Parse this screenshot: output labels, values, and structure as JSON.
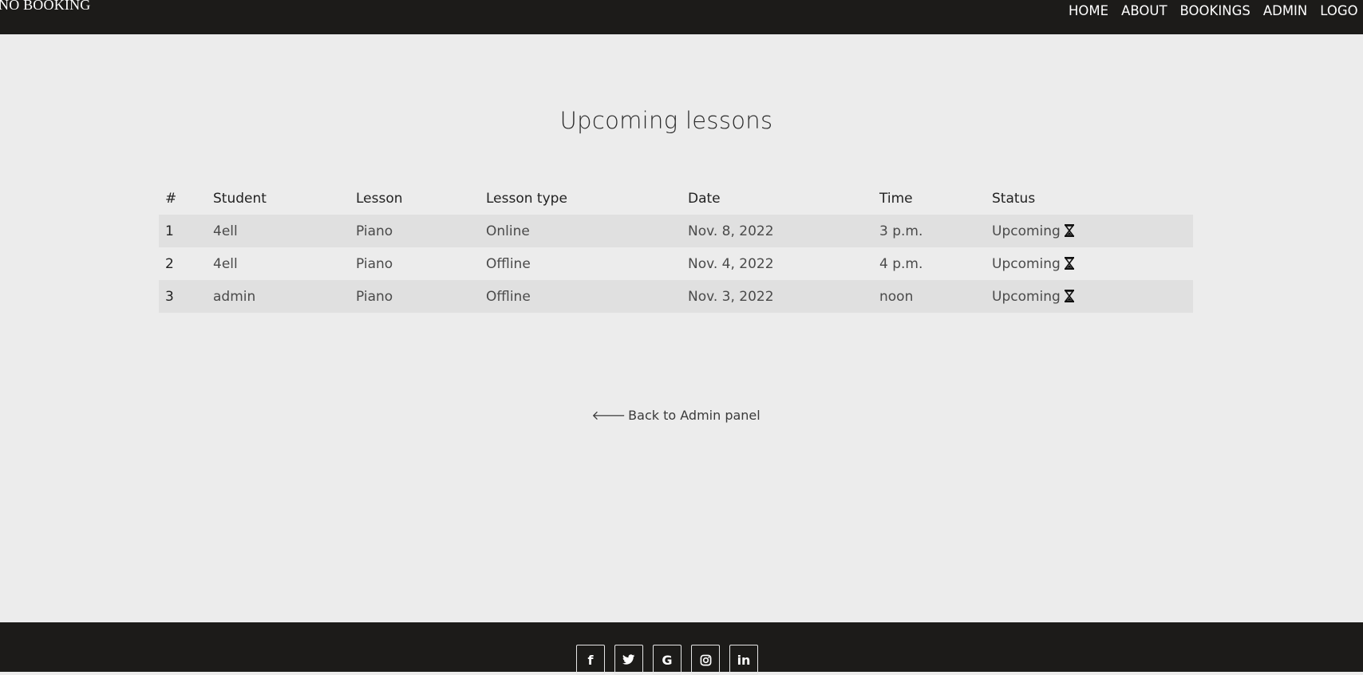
{
  "nav": {
    "brand": "NO BOOKING",
    "links": [
      "HOME",
      "ABOUT",
      "BOOKINGS",
      "ADMIN",
      "LOGO"
    ]
  },
  "page": {
    "title": "Upcoming lessons"
  },
  "table": {
    "headers": [
      "#",
      "Student",
      "Lesson",
      "Lesson type",
      "Date",
      "Time",
      "Status"
    ],
    "rows": [
      {
        "num": "1",
        "student": "4ell",
        "lesson": "Piano",
        "type": "Online",
        "date": "Nov. 8, 2022",
        "time": "3 p.m.",
        "status": "Upcoming"
      },
      {
        "num": "2",
        "student": "4ell",
        "lesson": "Piano",
        "type": "Offline",
        "date": "Nov. 4, 2022",
        "time": "4 p.m.",
        "status": "Upcoming"
      },
      {
        "num": "3",
        "student": "admin",
        "lesson": "Piano",
        "type": "Offline",
        "date": "Nov. 3, 2022",
        "time": "noon",
        "status": "Upcoming"
      }
    ]
  },
  "back_link": {
    "icon": "arrow-left-icon",
    "label": "Back to Admin panel"
  },
  "footer": {
    "socials": [
      {
        "icon": "facebook-icon",
        "glyph": "f"
      },
      {
        "icon": "twitter-icon",
        "glyph": "🐦"
      },
      {
        "icon": "google-icon",
        "glyph": "G"
      },
      {
        "icon": "instagram-icon",
        "glyph": "◎"
      },
      {
        "icon": "linkedin-icon",
        "glyph": "in"
      }
    ]
  },
  "colors": {
    "navbar_bg": "#1c1b19",
    "page_bg": "#ececec",
    "row_stripe": "#e0e0e0"
  }
}
